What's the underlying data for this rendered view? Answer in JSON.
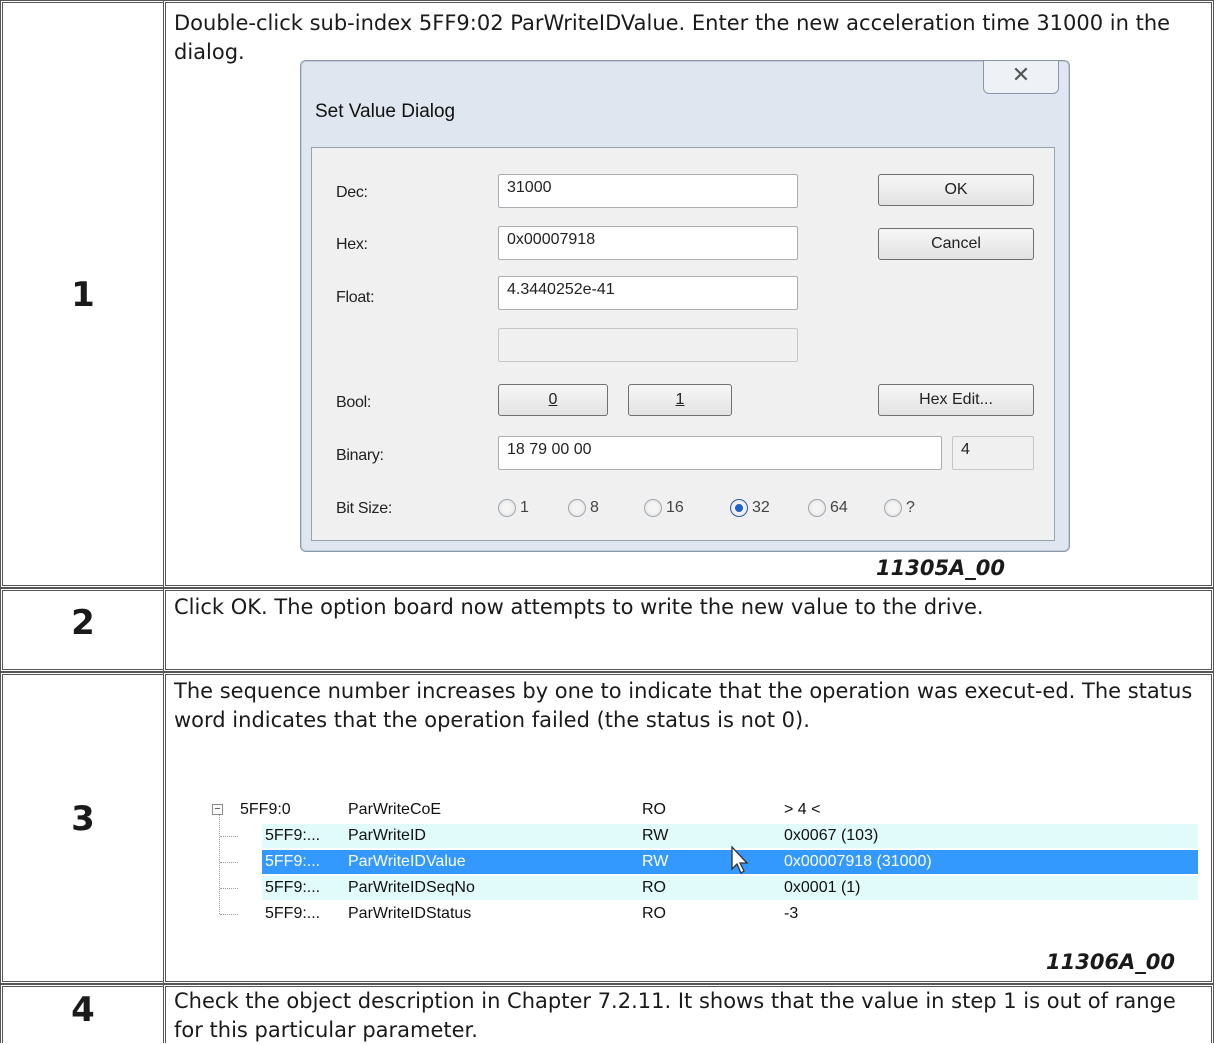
{
  "steps": [
    {
      "number": "1",
      "text": "Double-click sub-index 5FF9:02 ParWriteIDValue. Enter the new acceleration time 31000 in the dialog.",
      "figure_id": "11305A_00"
    },
    {
      "number": "2",
      "text": "Click OK. The option board now attempts to write the new value to the drive."
    },
    {
      "number": "3",
      "text": "The sequence number increases by one to indicate that the operation was execut-ed. The status word indicates that the operation failed (the status is not 0).",
      "figure_id": "11306A_00"
    },
    {
      "number": "4",
      "text": "Check the object description in Chapter 7.2.11. It shows that the value in step 1 is out of range for this particular parameter."
    }
  ],
  "dialog": {
    "title": "Set Value Dialog",
    "close_glyph": "✕",
    "labels": {
      "dec": "Dec:",
      "hex": "Hex:",
      "float": "Float:",
      "bool": "Bool:",
      "binary": "Binary:",
      "bit_size": "Bit Size:"
    },
    "fields": {
      "dec": "31000",
      "hex": "0x00007918",
      "float": "4.3440252e-41",
      "extra": "",
      "binary": "18 79 00 00",
      "byte_count": "4"
    },
    "buttons": {
      "ok": "OK",
      "cancel": "Cancel",
      "bool_0": "0",
      "bool_1": "1",
      "hex_edit": "Hex Edit..."
    },
    "bit_sizes": [
      "1",
      "8",
      "16",
      "32",
      "64",
      "?"
    ],
    "bit_size_selected": "32"
  },
  "tree": {
    "rows": [
      {
        "index": "5FF9:0",
        "name": "ParWriteCoE",
        "flags": "RO",
        "value": "> 4 <"
      },
      {
        "index": "5FF9:...",
        "name": "ParWriteID",
        "flags": "RW",
        "value": "0x0067 (103)"
      },
      {
        "index": "5FF9:...",
        "name": "ParWriteIDValue",
        "flags": "RW",
        "value": "0x00007918 (31000)"
      },
      {
        "index": "5FF9:...",
        "name": "ParWriteIDSeqNo",
        "flags": "RO",
        "value": "0x0001 (1)"
      },
      {
        "index": "5FF9:...",
        "name": "ParWriteIDStatus",
        "flags": "RO",
        "value": "-3"
      }
    ],
    "expander_glyph": "−"
  },
  "colors": {
    "row_highlight": "#e1fbfb",
    "row_selected": "#3399ff",
    "radio_checked": "#1d5fcc"
  }
}
